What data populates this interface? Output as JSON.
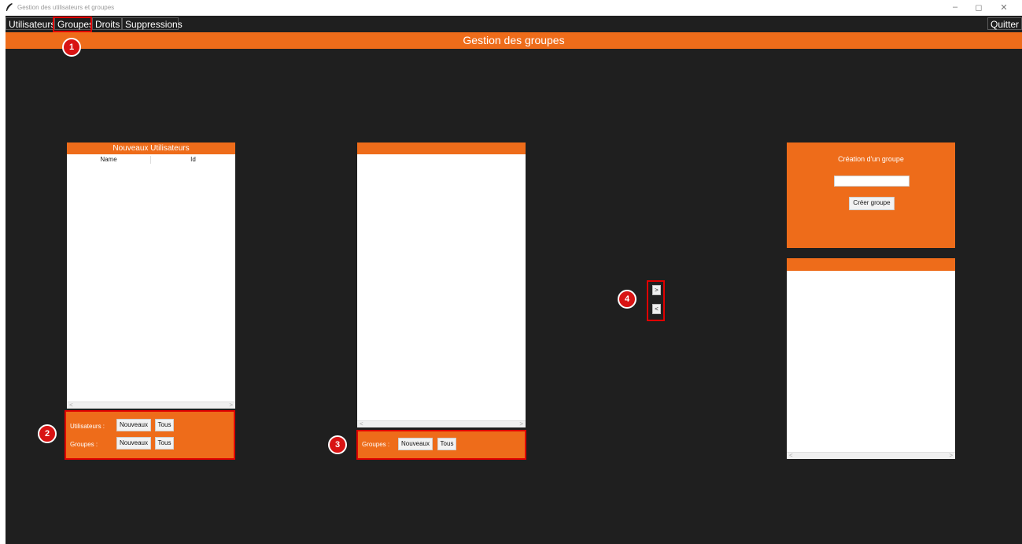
{
  "window": {
    "title": "Gestion des utilisateurs et groupes",
    "controls": [
      "–",
      "◻",
      "✕"
    ]
  },
  "menu": {
    "items": [
      {
        "label": "Utilisateurs"
      },
      {
        "label": "Groupes"
      },
      {
        "label": "Droits"
      },
      {
        "label": "Suppressions"
      }
    ],
    "quit_label": "Quitter"
  },
  "header": {
    "title": "Gestion des groupes"
  },
  "users_panel": {
    "title": "Nouveaux Utilisateurs",
    "columns": [
      "Name",
      "Id"
    ],
    "controls": {
      "users_label": "Utilisateurs :",
      "groups_label": "Groupes :",
      "new_label": "Nouveaux",
      "all_label": "Tous"
    }
  },
  "groups_panel": {
    "title": "",
    "controls": {
      "groups_label": "Groupes :",
      "new_label": "Nouveaux",
      "all_label": "Tous"
    }
  },
  "create_group": {
    "title": "Création d'un groupe",
    "input_value": "",
    "button_label": "Créer groupe"
  },
  "group_members_panel": {
    "title": ""
  },
  "transfer": {
    "add_label": ">",
    "remove_label": "<"
  },
  "annotations": [
    "1",
    "2",
    "3",
    "4"
  ],
  "colors": {
    "accent": "#ee6c1a",
    "background": "#1f1f1f",
    "highlight": "#e00000"
  },
  "icons": {
    "app": "feather-icon"
  }
}
